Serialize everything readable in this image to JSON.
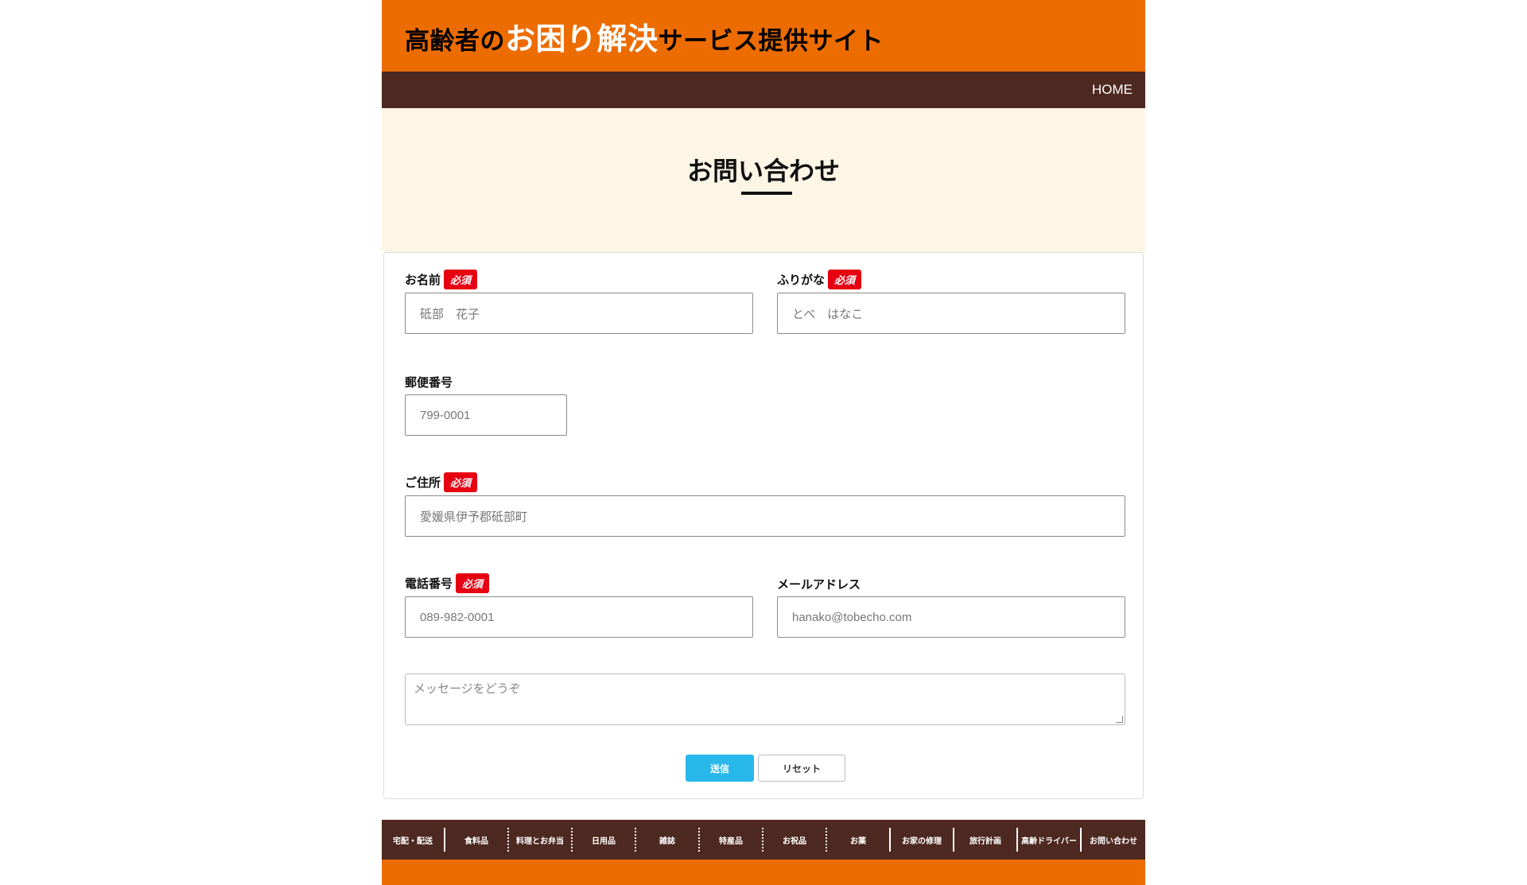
{
  "header": {
    "title_prefix": "高齢者の",
    "title_emph": "お困り解決",
    "title_suffix": "サービス提供サイト"
  },
  "nav": {
    "home": "HOME"
  },
  "hero": {
    "title": "お問い合わせ"
  },
  "form": {
    "required": "必須",
    "name": {
      "label": "お名前",
      "placeholder": "砥部　花子"
    },
    "furigana": {
      "label": "ふりがな",
      "placeholder": "とべ　はなこ"
    },
    "postal": {
      "label": "郵便番号",
      "placeholder": "799-0001"
    },
    "address": {
      "label": "ご住所",
      "placeholder": "愛媛県伊予郡砥部町"
    },
    "phone": {
      "label": "電話番号",
      "placeholder": "089-982-0001"
    },
    "email": {
      "label": "メールアドレス",
      "placeholder": "hanako@tobecho.com"
    },
    "message": {
      "placeholder": "メッセージをどうぞ"
    },
    "send": "送信",
    "reset": "リセット"
  },
  "footer": {
    "items": [
      "宅配・配送",
      "食料品",
      "料理とお弁当",
      "日用品",
      "雑誌",
      "特産品",
      "お祝品",
      "お薬",
      "お家の修理",
      "旅行計画",
      "高齢ドライバー",
      "お問い合わせ"
    ]
  },
  "colors": {
    "orange": "#ec6c00",
    "brown": "#4e2921",
    "cream": "#fdf5e6",
    "required_red": "#e60012",
    "send_blue": "#29b8ea"
  }
}
